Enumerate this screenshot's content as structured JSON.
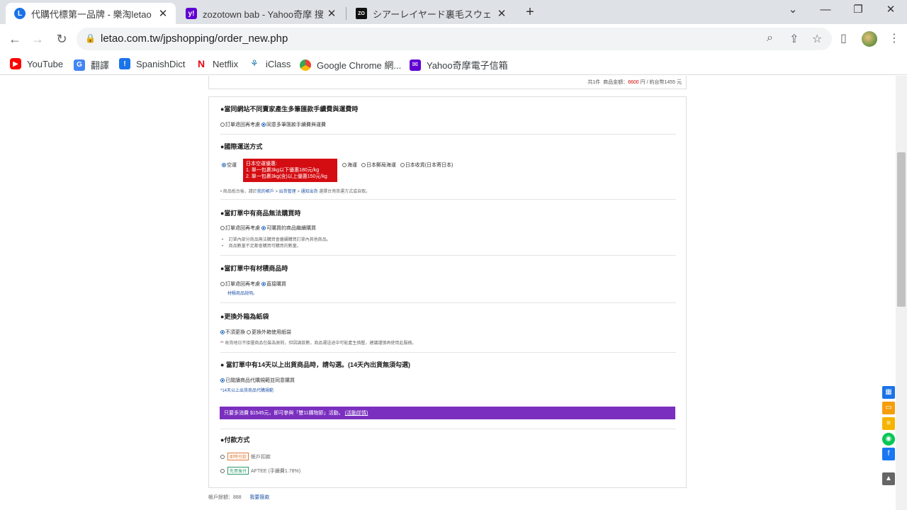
{
  "tabs": [
    {
      "title": "代購代標第一品牌 - 樂淘letao -",
      "active": true
    },
    {
      "title": "zozotown bab - Yahoo奇摩 搜尋",
      "active": false
    },
    {
      "title": "シアーレイヤード裏毛スウェッ",
      "active": false
    }
  ],
  "address": {
    "url": "letao.com.tw/jpshopping/order_new.php"
  },
  "bookmarks": [
    "YouTube",
    "翻譯",
    "SpanishDict",
    "Netflix",
    "iClass",
    "Google Chrome 網...",
    "Yahoo奇摩電子信箱"
  ],
  "summary": {
    "count": "共1件",
    "label": "商品金額：",
    "amount": "6600",
    "suffix": "円 / 約台幣1455 元"
  },
  "sections": {
    "remit": {
      "title": "●當同網站不同賣家產生多筆匯款手續費與運費時",
      "opt1": "訂單退回再考慮",
      "opt2": "同意多筆匯款手續費與運費"
    },
    "shipping": {
      "title": "●國際運送方式",
      "air": "空運",
      "promo_title": "日本空運優惠:",
      "promo_1": "1. 單一包裹3kg以下優惠180元/kg",
      "promo_2": "2. 單一包裹3kg(含)以上優惠150元/kg",
      "sea": "海運",
      "ems": "日本郵局海運",
      "jp_receive": "日本收貨(日本寄日本)",
      "note_pre": "• 商品抵台後，請於",
      "note_link1": "我的帳戶",
      "note_mid1": " > ",
      "note_link2": "出貨管理",
      "note_mid2": " > ",
      "note_link3": "通知出貨",
      "note_post": " 選擇台灣貨運方式或自取。"
    },
    "unavailable": {
      "title": "●當訂單中有商品無法購買時",
      "opt1": "訂單退回再考慮",
      "opt2": "可購買的商品繼續購買",
      "note1": "• 　訂單內部分商品無法購買會繼續購買訂單內其他商品。",
      "note2": "• 　商品數量不足都會購買可購買的數量。"
    },
    "bulky": {
      "title": "●當訂單中有材積商品時",
      "opt1": "訂單退回再考慮",
      "opt2": "直接購買",
      "link": "材積商品說明。"
    },
    "box": {
      "title": "●更換外箱為紙袋",
      "opt1": "不須更換",
      "opt2": "更換外箱使用紙袋",
      "note": "* 收貨地日不接優商品包裝為原則，但因調款數，商品運送途中可能產生擠壓，建議謹慎再使用此服務。"
    },
    "late": {
      "title": "● 當訂單中有14天以上出貨商品時，請勾選。(14天內出貨無須勾選)",
      "opt1": "已閱讀商品代購規範並同意購買",
      "link": "*14天以上出貨商品代購規範"
    },
    "promo_bar": {
      "text": "只要多消費 $1545元，即可參與「雙11購物節」活動。",
      "link": "(活動詳情)"
    },
    "payment": {
      "title": "●付款方式",
      "tag1": "即時付款",
      "opt1": "帳戶扣款",
      "tag2": "先買後付",
      "opt2": "AFTEE (手續費1.78%)"
    }
  },
  "bottom": {
    "balance": "帳戶餘額：888",
    "link": "我要匯款"
  },
  "colors": {
    "accent": "#1a5fb4",
    "promo": "#d40d12",
    "purple": "#7b2fbf"
  }
}
